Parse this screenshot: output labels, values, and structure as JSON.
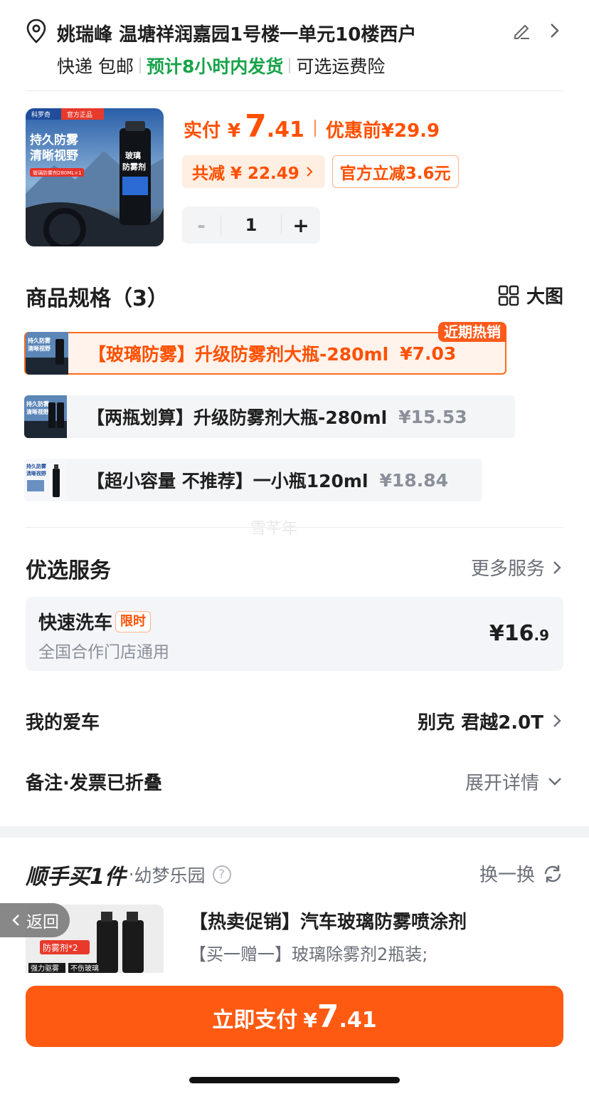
{
  "address": {
    "line": "姚瑞峰 温塘祥润嘉园1号楼一单元10楼西户",
    "shipping": "快递 包邮",
    "eta": "预计8小时内发货",
    "insurance": "可选运费险"
  },
  "product": {
    "image_brand": "科罗奇",
    "image_badge": "官方正品",
    "image_headline_1": "持久防雾",
    "image_headline_2": "清晰视野",
    "image_caption": "玻璃防雾剂280ML×1",
    "can_label_1": "玻璃",
    "can_label_2": "防雾剂",
    "price_label": "实付",
    "currency": "¥",
    "price_int": "7",
    "price_dec": ".41",
    "before_label": "优惠前",
    "before_price": "¥29.9",
    "discount_total": "共减 ¥ 22.49",
    "discount_official": "官方立减3.6元",
    "quantity": "1",
    "minus": "-",
    "plus": "+"
  },
  "specs": {
    "title": "商品规格（3）",
    "big_view": "大图",
    "items": [
      {
        "name": "【玻璃防雾】升级防雾剂大瓶-280ml",
        "price": "¥7.03",
        "badge": "近期热销",
        "selected": true
      },
      {
        "name": "【两瓶划算】升级防雾剂大瓶-280ml",
        "price": "¥15.53",
        "selected": false
      },
      {
        "name": "【超小容量 不推荐】一小瓶120ml",
        "price": "¥18.84",
        "selected": false
      }
    ],
    "thumb_text_1": "持久防雾",
    "thumb_text_2": "清晰视野"
  },
  "watermark": "雪芊年",
  "services": {
    "title": "优选服务",
    "more": "更多服务",
    "card_name": "快速洗车",
    "card_tag": "限时",
    "card_desc": "全国合作门店通用",
    "card_price_main": "¥16",
    "card_price_dec": ".9"
  },
  "car": {
    "label": "我的爱车",
    "value": "别克 君越2.0T"
  },
  "notes": {
    "label": "备注·发票已折叠",
    "value": "展开详情"
  },
  "addon": {
    "title": "顺手买1件",
    "location": "幼梦乐园",
    "help": "?",
    "swap": "换一换",
    "name": "【热卖促销】汽车玻璃防雾喷涂剂",
    "desc": "【买一赠一】玻璃除雾剂2瓶装;",
    "img_tag": "防雾剂*2",
    "img_tag2": "强力驱雾",
    "img_tag3": "不伤玻璃"
  },
  "back": "返回",
  "pay": {
    "label": "立即支付",
    "currency": "¥",
    "int": "7",
    "dec": ".41"
  },
  "colors": {
    "accent": "#ff5000",
    "green": "#18a34a",
    "button": "#ff5a12"
  }
}
